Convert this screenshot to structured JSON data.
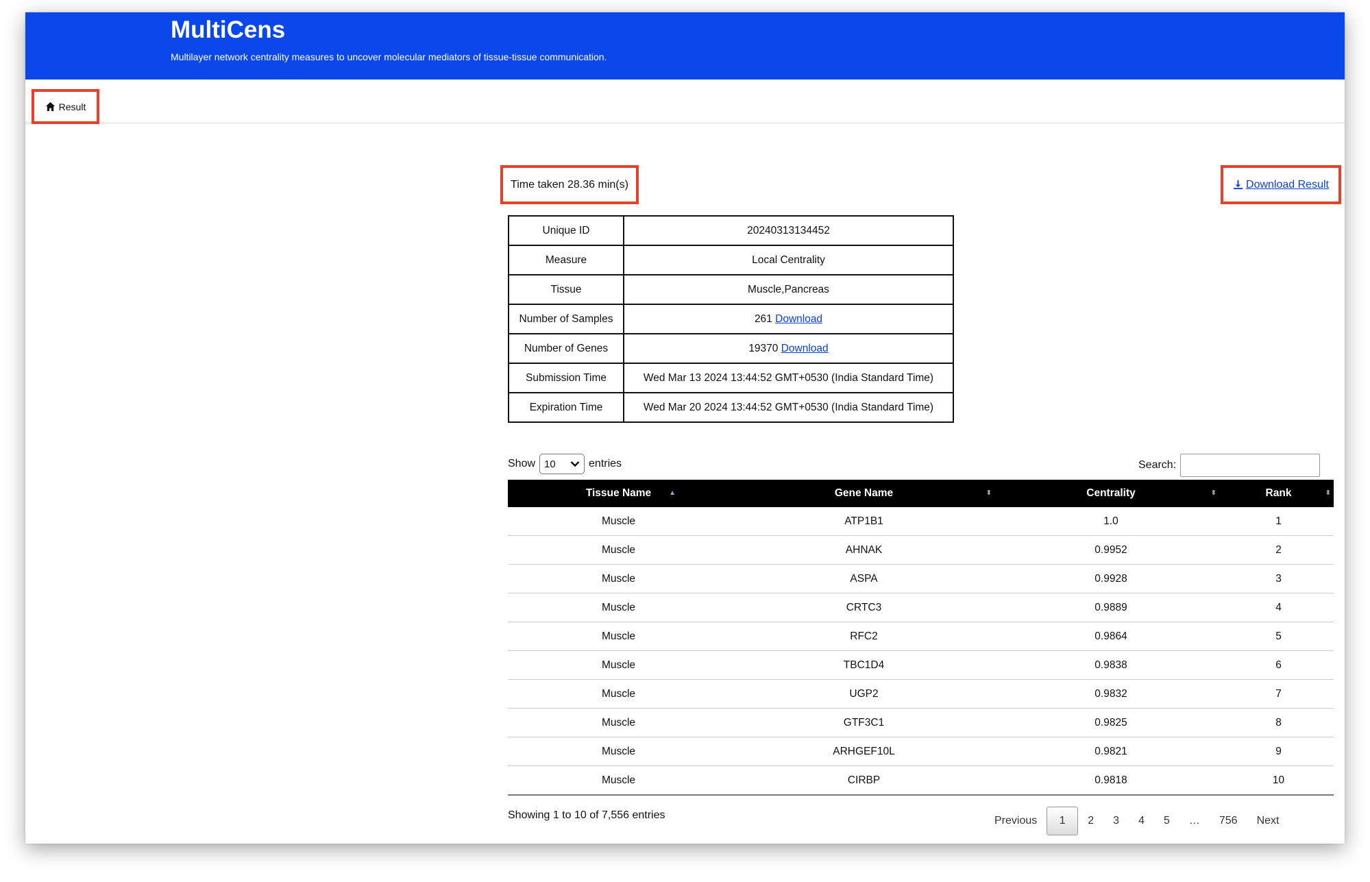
{
  "header": {
    "title": "MultiCens",
    "subtitle": "Multilayer network centrality measures to uncover molecular mediators of tissue-tissue communication."
  },
  "tab": {
    "label": "Result",
    "icon": "home-icon"
  },
  "time_taken": "Time taken 28.36 min(s)",
  "download_result": {
    "label": "Download Result",
    "icon": "download-icon"
  },
  "info": {
    "rows": [
      {
        "key": "Unique ID",
        "value": "20240313134452"
      },
      {
        "key": "Measure",
        "value": "Local Centrality"
      },
      {
        "key": "Tissue",
        "value": "Muscle,Pancreas"
      },
      {
        "key": "Number of Samples",
        "value": "261",
        "link": "Download"
      },
      {
        "key": "Number of Genes",
        "value": "19370",
        "link": "Download"
      },
      {
        "key": "Submission Time",
        "value": "Wed Mar 13 2024 13:44:52 GMT+0530 (India Standard Time)"
      },
      {
        "key": "Expiration Time",
        "value": "Wed Mar 20 2024 13:44:52 GMT+0530 (India Standard Time)"
      }
    ]
  },
  "length": {
    "show": "Show",
    "selected": "10",
    "entries": "entries"
  },
  "search": {
    "label": "Search:",
    "value": ""
  },
  "table": {
    "columns": [
      "Tissue Name",
      "Gene Name",
      "Centrality",
      "Rank"
    ],
    "rows": [
      [
        "Muscle",
        "ATP1B1",
        "1.0",
        "1"
      ],
      [
        "Muscle",
        "AHNAK",
        "0.9952",
        "2"
      ],
      [
        "Muscle",
        "ASPA",
        "0.9928",
        "3"
      ],
      [
        "Muscle",
        "CRTC3",
        "0.9889",
        "4"
      ],
      [
        "Muscle",
        "RFC2",
        "0.9864",
        "5"
      ],
      [
        "Muscle",
        "TBC1D4",
        "0.9838",
        "6"
      ],
      [
        "Muscle",
        "UGP2",
        "0.9832",
        "7"
      ],
      [
        "Muscle",
        "GTF3C1",
        "0.9825",
        "8"
      ],
      [
        "Muscle",
        "ARHGEF10L",
        "0.9821",
        "9"
      ],
      [
        "Muscle",
        "CIRBP",
        "0.9818",
        "10"
      ]
    ]
  },
  "footer": {
    "info": "Showing 1 to 10 of 7,556 entries",
    "previous": "Previous",
    "pages": [
      "1",
      "2",
      "3",
      "4",
      "5",
      "…",
      "756"
    ],
    "current": "1",
    "next": "Next"
  }
}
